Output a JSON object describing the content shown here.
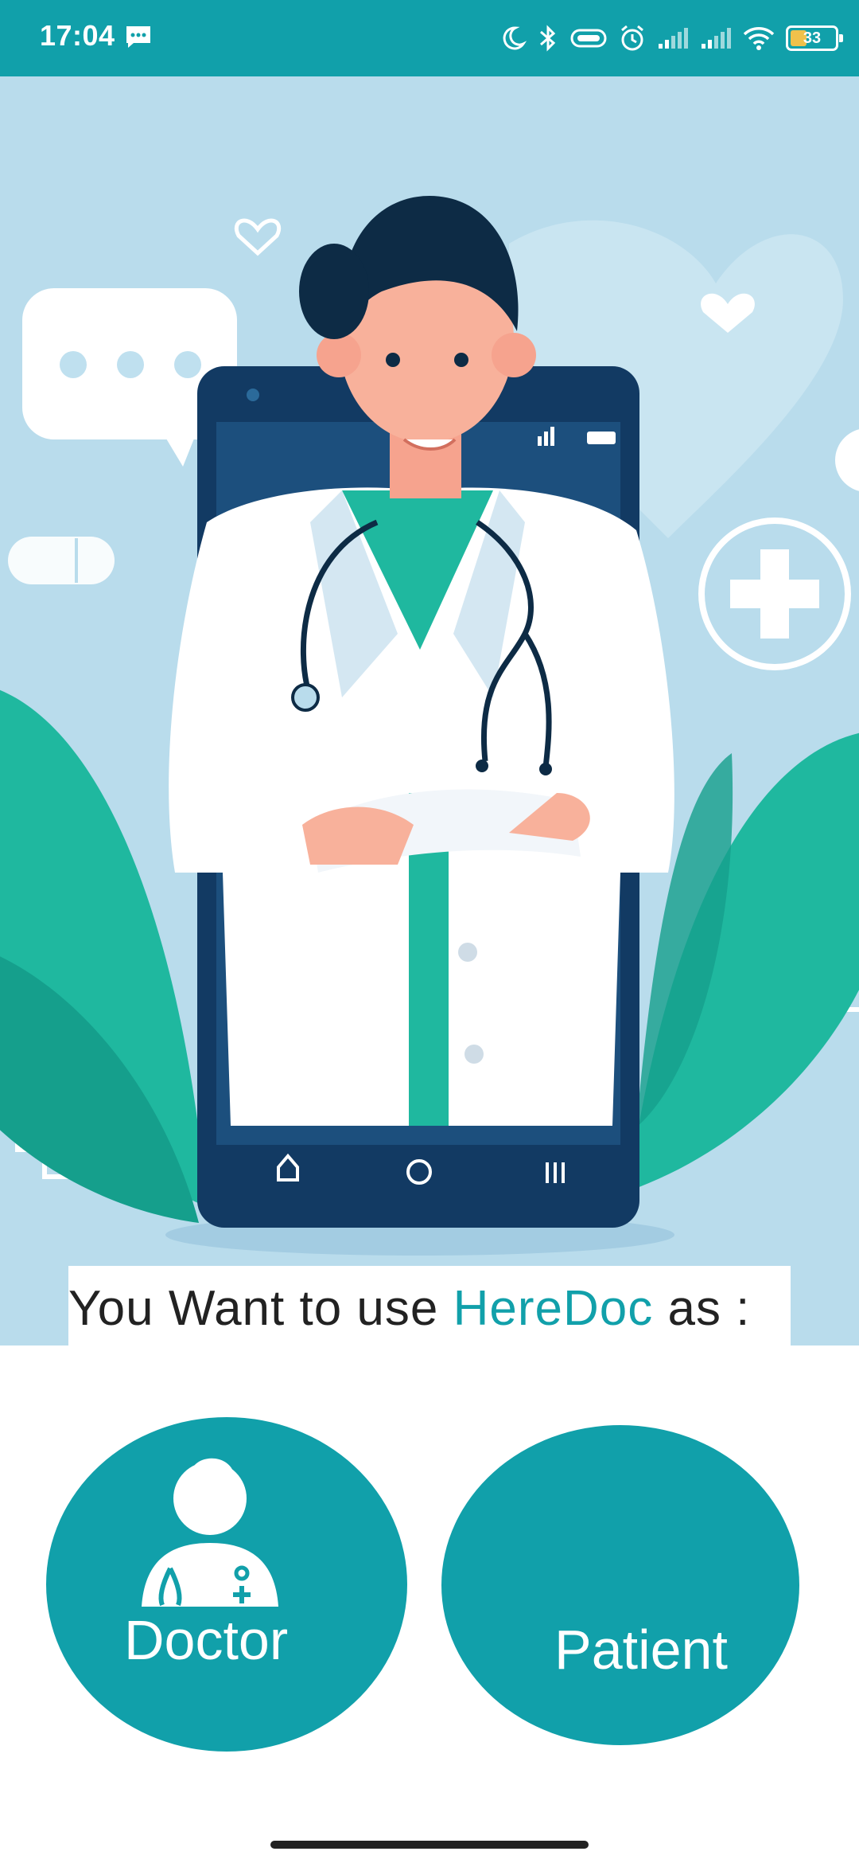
{
  "status_bar": {
    "time": "17:04",
    "battery_level": "33",
    "icons": [
      "message-icon",
      "moon-icon",
      "bluetooth-icon",
      "vibrate-icon",
      "alarm-icon",
      "signal-icon",
      "signal-icon",
      "wifi-icon",
      "battery-icon"
    ]
  },
  "prompt": {
    "before": "You Want to use ",
    "brand": "HereDoc",
    "after": " as :"
  },
  "roles": {
    "doctor_label": "Doctor",
    "patient_label": "Patient"
  },
  "colors": {
    "accent": "#11A0AA",
    "hero_bg": "#b9dcec",
    "leaf": "#1fb89f",
    "phone": "#123a63"
  }
}
